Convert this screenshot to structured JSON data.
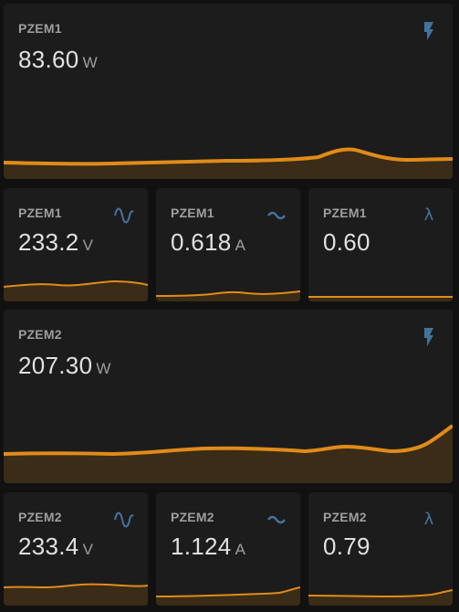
{
  "colors": {
    "accent": "#e08b1a",
    "icon": "#44739e",
    "card": "#1c1c1c",
    "background": "#111111"
  },
  "cards": [
    {
      "name": "PZEM1",
      "value": "83.60",
      "unit": "W",
      "icon": "flash-icon"
    },
    {
      "name": "PZEM1",
      "value": "233.2",
      "unit": "V",
      "icon": "sine-wave-icon"
    },
    {
      "name": "PZEM1",
      "value": "0.618",
      "unit": "A",
      "icon": "current-ac-icon"
    },
    {
      "name": "PZEM1",
      "value": "0.60",
      "unit": "",
      "icon": "lambda-icon"
    },
    {
      "name": "PZEM2",
      "value": "207.30",
      "unit": "W",
      "icon": "flash-icon"
    },
    {
      "name": "PZEM2",
      "value": "233.4",
      "unit": "V",
      "icon": "sine-wave-icon"
    },
    {
      "name": "PZEM2",
      "value": "1.124",
      "unit": "A",
      "icon": "current-ac-icon"
    },
    {
      "name": "PZEM2",
      "value": "0.79",
      "unit": "",
      "icon": "lambda-icon"
    }
  ],
  "icon_glyphs": {
    "lambda": "λ"
  }
}
